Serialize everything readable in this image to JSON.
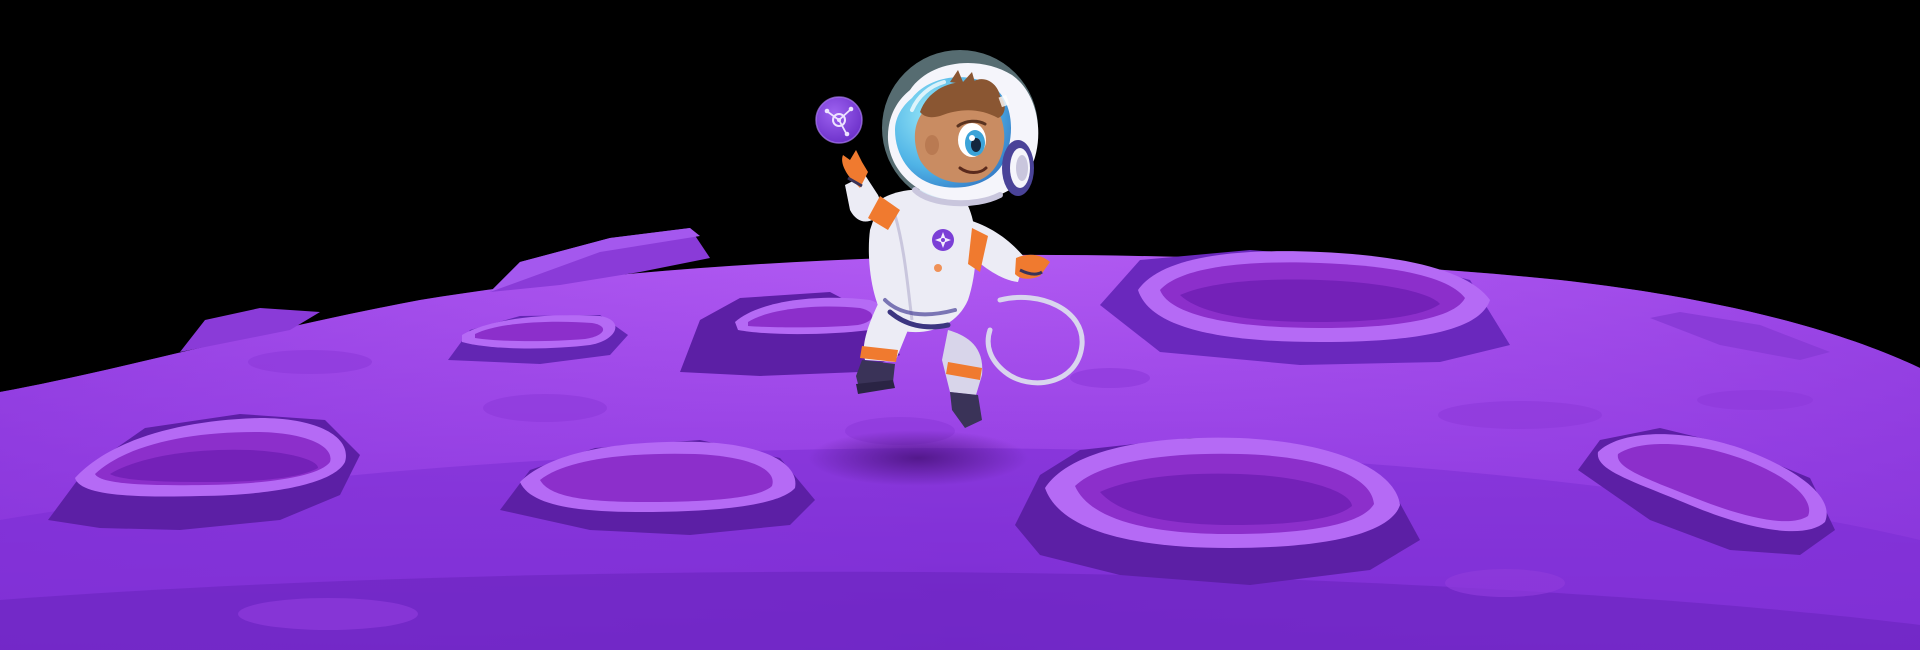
{
  "scene": {
    "subject": "cartoon-astronaut",
    "setting": "purple-moon-surface",
    "background_color": "#000000"
  },
  "colors": {
    "surface_light": "#B15AF2",
    "surface_mid": "#9A44E6",
    "surface_dark": "#7A2BD3",
    "surface_deep": "#6A24BE",
    "crater_rim": "#B56AF5",
    "crater_inner": "#8C2FCB",
    "crater_inner_dark": "#7421B8",
    "crater_shadow": "#5C1FA5",
    "suit_white": "#ECECF5",
    "suit_shade": "#C9C6DD",
    "suit_orange": "#F07A2F",
    "visor_cyan": "#68D8F0",
    "visor_blue": "#2F83C9",
    "skin": "#C98C62",
    "hair": "#8A5632",
    "badge_purple": "#7B3FD6",
    "drop_shadow": "#4A137E"
  },
  "icons": {
    "floating_orb": "orbit-network-icon",
    "suit_badge": "compass-star-icon"
  }
}
